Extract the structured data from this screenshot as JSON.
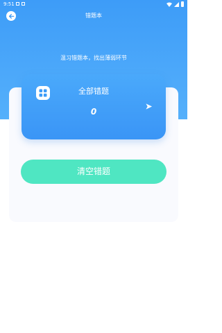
{
  "status_bar": {
    "time": "9:51"
  },
  "header": {
    "title": "错题本"
  },
  "subtitle": "温习错题本，找出薄弱环节",
  "card": {
    "title": "全部错题",
    "count": "0",
    "icon": "grid-icon",
    "arrow_icon": "arrow-right-icon"
  },
  "actions": {
    "clear_label": "清空错题"
  },
  "colors": {
    "header_blue": "#3d9cf8",
    "card_blue": "#4aa9fb",
    "clear_button": "#4fe6c2",
    "panel_bg": "#f9fafe"
  }
}
